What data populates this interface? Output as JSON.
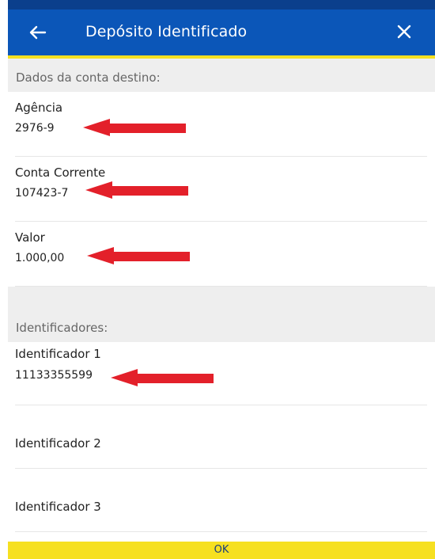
{
  "appbar": {
    "title": "Depósito Identificado",
    "back_icon": "arrow-left-icon",
    "close_icon": "close-icon"
  },
  "section_destination": {
    "header": "Dados da conta destino:",
    "fields": [
      {
        "label": "Agência",
        "value": "2976-9"
      },
      {
        "label": "Conta Corrente",
        "value": "107423-7"
      },
      {
        "label": "Valor",
        "value": "1.000,00"
      }
    ]
  },
  "section_identifiers": {
    "header": "Identificadores:",
    "fields": [
      {
        "label": "Identificador 1",
        "value": "11133355599"
      },
      {
        "label": "Identificador 2",
        "value": ""
      },
      {
        "label": "Identificador 3",
        "value": ""
      }
    ]
  },
  "footer": {
    "ok_label": "OK"
  },
  "colors": {
    "appbar": "#0b56b8",
    "status_bar": "#0b3f8c",
    "accent_yellow": "#f6e021",
    "annotation_arrow": "#e3202a",
    "section_bg": "#eeeeee"
  }
}
